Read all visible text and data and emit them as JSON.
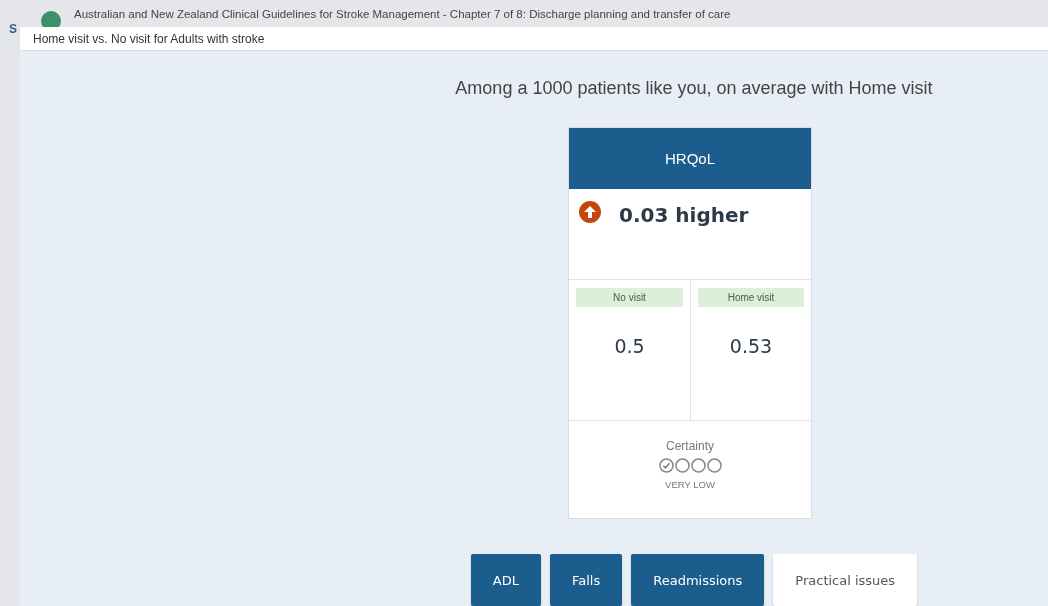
{
  "background_page": {
    "title": "Australian and New Zealand Clinical Guidelines for Stroke Management - Chapter 7 of 8: Discharge planning and transfer of care",
    "side_letter": "S"
  },
  "dialog": {
    "title": "Home visit vs. No visit for Adults with stroke"
  },
  "headline": "Among a 1000 patients like you, on average with Home visit",
  "card": {
    "outcome": "HRQoL",
    "increase": true,
    "effect": "0.03 higher",
    "groups": [
      {
        "label": "No visit",
        "value": "0.5"
      },
      {
        "label": "Home visit",
        "value": "0.53"
      }
    ],
    "certainty": {
      "label": "Certainty",
      "circles": [
        {
          "checked": true
        },
        {
          "checked": false
        },
        {
          "checked": false
        },
        {
          "checked": false
        }
      ],
      "rating": "VERY LOW"
    }
  },
  "outcome_buttons": [
    {
      "label": "ADL",
      "kind": "outcome"
    },
    {
      "label": "Falls",
      "kind": "outcome"
    },
    {
      "label": "Readmissions",
      "kind": "outcome"
    },
    {
      "label": "Practical issues",
      "kind": "info"
    }
  ]
}
